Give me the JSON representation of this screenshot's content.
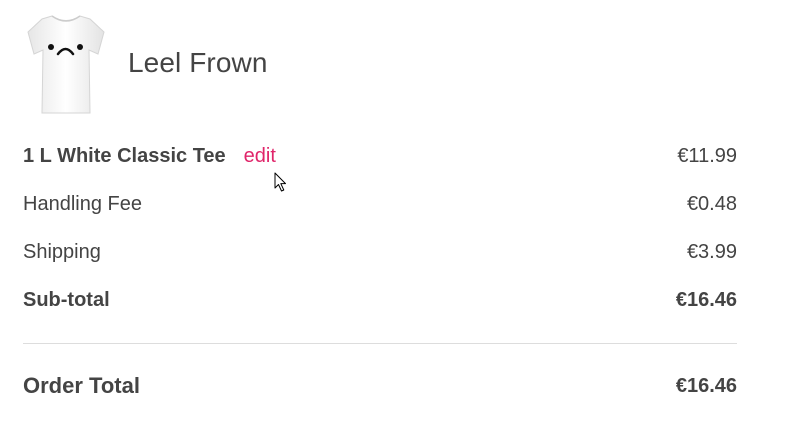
{
  "product": {
    "name": "Leel Frown",
    "image_icon": "tshirt-frown-icon"
  },
  "line_item": {
    "description": "1 L White Classic Tee",
    "edit_label": "edit",
    "price": "€11.99"
  },
  "fees": [
    {
      "label": "Handling Fee",
      "price": "€0.48"
    },
    {
      "label": "Shipping",
      "price": "€3.99"
    }
  ],
  "subtotal": {
    "label": "Sub-total",
    "price": "€16.46"
  },
  "order_total": {
    "label": "Order Total",
    "price": "€16.46"
  },
  "colors": {
    "accent": "#e0256a",
    "text": "#444444",
    "divider": "#dddddd"
  }
}
